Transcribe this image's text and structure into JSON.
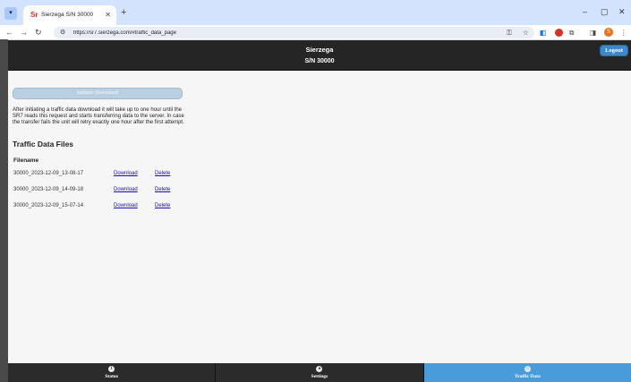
{
  "browser": {
    "tab_title": "Sierzega S/N 30000",
    "favicon_text": "Sr",
    "url": "https://sr7.sierzega.com/#traffic_data_page",
    "profile_initial": "S"
  },
  "header": {
    "title": "Sierzega",
    "subtitle": "S/N 30000",
    "logout_label": "Logout"
  },
  "main": {
    "initiate_button_label": "Initiate Download",
    "info_text": "After initiating a traffic data download it will take up to one hour until the SR7 reads this request and starts transferring data to the server. In case the transfer fails the unit will retry exactly one hour after the first attempt.",
    "section_title": "Traffic Data Files",
    "column_header": "Filename",
    "files": [
      {
        "filename": "30000_2023-12-09_13-08-17",
        "download": "Download",
        "delete": "Delete"
      },
      {
        "filename": "30000_2023-12-09_14-09-18",
        "download": "Download",
        "delete": "Delete"
      },
      {
        "filename": "30000_2023-12-09_15-07-14",
        "download": "Download",
        "delete": "Delete"
      }
    ]
  },
  "bottom_nav": {
    "items": [
      {
        "label": "Status",
        "icon": "info-icon",
        "glyph": "i"
      },
      {
        "label": "Settings",
        "icon": "gear-icon",
        "glyph": "●"
      },
      {
        "label": "Traffic Data",
        "icon": "circle-icon",
        "glyph": "○"
      }
    ],
    "active": "Traffic Data"
  },
  "colors": {
    "header_bg": "#252525",
    "accent": "#4a9bd9",
    "link": "#1a0dab"
  }
}
